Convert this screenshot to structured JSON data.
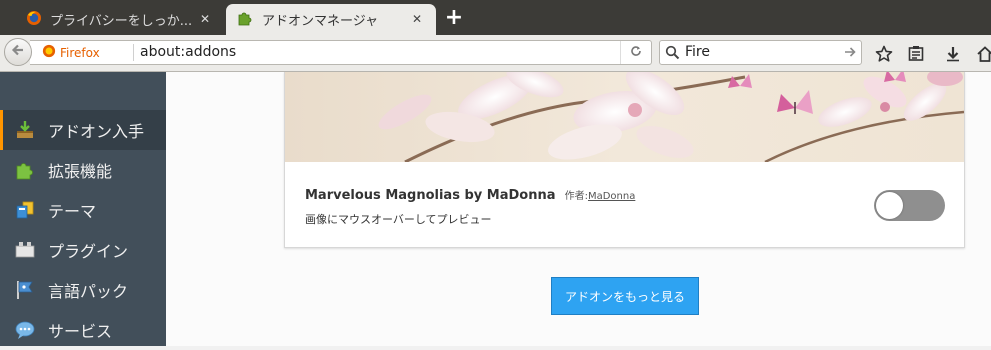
{
  "tabs": [
    {
      "title": "プライバシーをしっか...",
      "icon": "firefox-icon",
      "active": false
    },
    {
      "title": "アドオンマネージャ",
      "icon": "puzzle-icon",
      "active": true
    }
  ],
  "navbar": {
    "identity_label": "Firefox",
    "url": "about:addons",
    "search_value": "Fire"
  },
  "toolbar_icons": [
    "star-icon",
    "reading-list-icon",
    "download-icon",
    "home-icon"
  ],
  "sidebar": {
    "categories": [
      {
        "label": "アドオン入手",
        "icon": "get-addons-icon",
        "selected": true
      },
      {
        "label": "拡張機能",
        "icon": "extensions-puzzle-icon",
        "selected": false
      },
      {
        "label": "テーマ",
        "icon": "themes-icon",
        "selected": false
      },
      {
        "label": "プラグイン",
        "icon": "plugins-icon",
        "selected": false
      },
      {
        "label": "言語パック",
        "icon": "language-flag-icon",
        "selected": false
      },
      {
        "label": "サービス",
        "icon": "services-bubble-icon",
        "selected": false
      }
    ]
  },
  "addon": {
    "name": "Marvelous Magnolias by MaDonna",
    "creator_prefix": "作者:",
    "creator": "MaDonna",
    "description": "画像にマウスオーバーしてプレビュー",
    "enabled": false
  },
  "more_button": "アドオンをもっと見る",
  "colors": {
    "sidebar_bg": "#424f5a",
    "selected_accent": "#ff9500",
    "button_blue": "#2ea3f2",
    "tabstrip_bg": "#3c3b37"
  }
}
